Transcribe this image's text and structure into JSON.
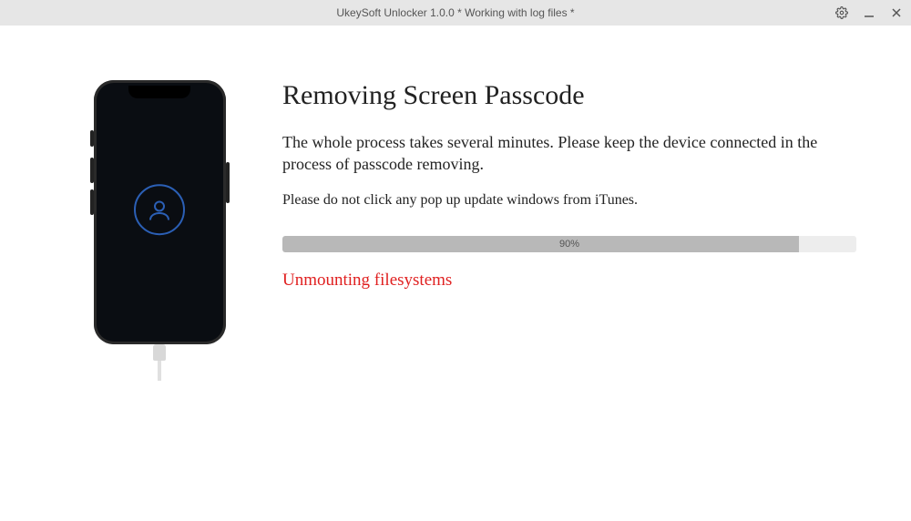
{
  "titlebar": {
    "title": "UkeySoft Unlocker 1.0.0 * Working with log files *"
  },
  "main": {
    "heading": "Removing Screen Passcode",
    "description": "The whole process takes several minutes. Please keep the device connected in the process of passcode removing.",
    "warning": "Please do not click any pop up update windows from iTunes.",
    "progress_percent": 90,
    "progress_label": "90%",
    "status": "Unmounting filesystems"
  }
}
